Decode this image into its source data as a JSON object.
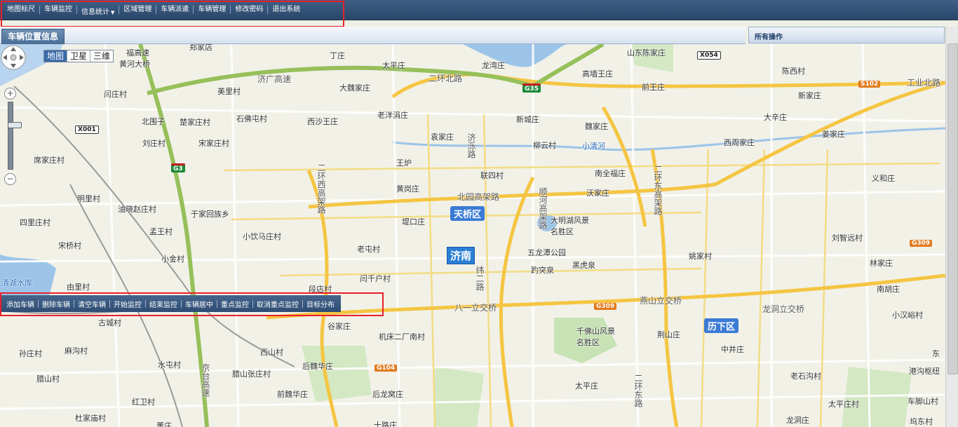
{
  "topnav": {
    "items": [
      "地图标尺",
      "车辆监控",
      "信息统计",
      "区域管理",
      "车辆派遣",
      "车辆管理",
      "修改密码",
      "退出系统"
    ]
  },
  "panel": {
    "title": "车辆位置信息"
  },
  "side_panel": {
    "title": "所有操作"
  },
  "map_type": {
    "options": [
      "地图",
      "卫星",
      "三维"
    ],
    "active": "地图"
  },
  "zoom": {
    "in": "+",
    "out": "−"
  },
  "toolbar": {
    "items": [
      "添加车辆",
      "删除车辆",
      "清空车辆",
      "开始监控",
      "结束监控",
      "车辆居中",
      "重点监控",
      "取消重点监控",
      "目标分布"
    ]
  },
  "map": {
    "districts": [
      "天桥区",
      "历下区"
    ],
    "city": "济南",
    "shields": [
      {
        "text": "G35",
        "type": "g"
      },
      {
        "text": "G3",
        "type": "g"
      },
      {
        "text": "X001",
        "type": "w"
      },
      {
        "text": "X054",
        "type": "w"
      },
      {
        "text": "S102",
        "type": "o"
      },
      {
        "text": "G309",
        "type": "o"
      },
      {
        "text": "G309",
        "type": "o"
      },
      {
        "text": "G104",
        "type": "o"
      }
    ],
    "labels": [
      "福高速",
      "黄河大桥",
      "郑家店",
      "丁庄",
      "太平庄",
      "龙湾庄",
      "山东陈家庄",
      "陈西村",
      "济广高速",
      "大魏家庄",
      "二环北路",
      "高墙王庄",
      "前王庄",
      "新家庄",
      "工业北路",
      "闫庄村",
      "美里村",
      "石佛屯村",
      "老洋涓庄",
      "新城庄",
      "魏家庄",
      "大辛庄",
      "北围子",
      "楚家庄村",
      "西沙王庄",
      "袁家庄",
      "济泺路",
      "柳云村",
      "小清河",
      "姜家庄",
      "西周家庄",
      "刘庄村",
      "宋家庄村",
      "王炉",
      "联四村",
      "南全福庄",
      "义和庄",
      "席家庄村",
      "黄岗庄",
      "沃家庄",
      "明里村",
      "二环西高架路",
      "北园高架路",
      "顺河高架路",
      "二环东高架路",
      "油晓赵庄村",
      "于家回族乡",
      "堤口庄",
      "大明湖风景名胜区",
      "四里庄村",
      "孟王村",
      "小饮马庄村",
      "刘智远村",
      "宋桥村",
      "老屯村",
      "五龙潭公园",
      "姚家村",
      "小金村",
      "闫千户村",
      "趵突泉",
      "黑虎泉",
      "林家庄",
      "清湖水库",
      "由里村",
      "段店村",
      "纬二路",
      "南胡庄",
      "古城村",
      "八一立交桥",
      "燕山立交桥",
      "龙洞立交桥",
      "小汉峪村",
      "谷家庄",
      "机床二厂南村",
      "千佛山风景名胜区",
      "荆山庄",
      "孙庄村",
      "麻沟村",
      "西山村",
      "中井庄",
      "东",
      "水屯村",
      "腊山张庄村",
      "后魏华庄",
      "京台高速",
      "港沟枢纽",
      "腊山村",
      "老石沟村",
      "前魏华庄",
      "后龙窝庄",
      "太平庄",
      "二环东路",
      "红卫村",
      "太平庄村",
      "车脚山村",
      "杜家庙村",
      "董庄",
      "十路庄",
      "龙洞庄",
      "坞东村",
      "工业北路",
      "二环东路"
    ]
  }
}
